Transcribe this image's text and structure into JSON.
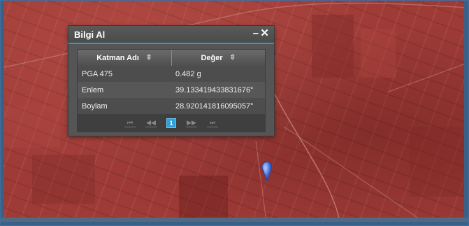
{
  "dialog": {
    "title": "Bilgi Al",
    "minimize_glyph": "–",
    "close_glyph": "✕"
  },
  "table": {
    "columns": [
      "Katman Adı",
      "Değer"
    ],
    "rows": [
      {
        "layer": "PGA 475",
        "value": "0.482 g"
      },
      {
        "layer": "Enlem",
        "value": "39.133419433831676°"
      },
      {
        "layer": "Boylam",
        "value": "28.920141816095057°"
      }
    ]
  },
  "pager": {
    "first": "⏮",
    "prev": "◀◀",
    "current_page": "1",
    "next": "▶▶",
    "last": "⏭"
  },
  "map": {
    "tint": "#9f3b37",
    "marker_icon": "map-pin-icon",
    "marker_color": "#3f6fe0"
  },
  "colors": {
    "accent": "#2f97c9",
    "page_button": "#2aa1dd"
  }
}
